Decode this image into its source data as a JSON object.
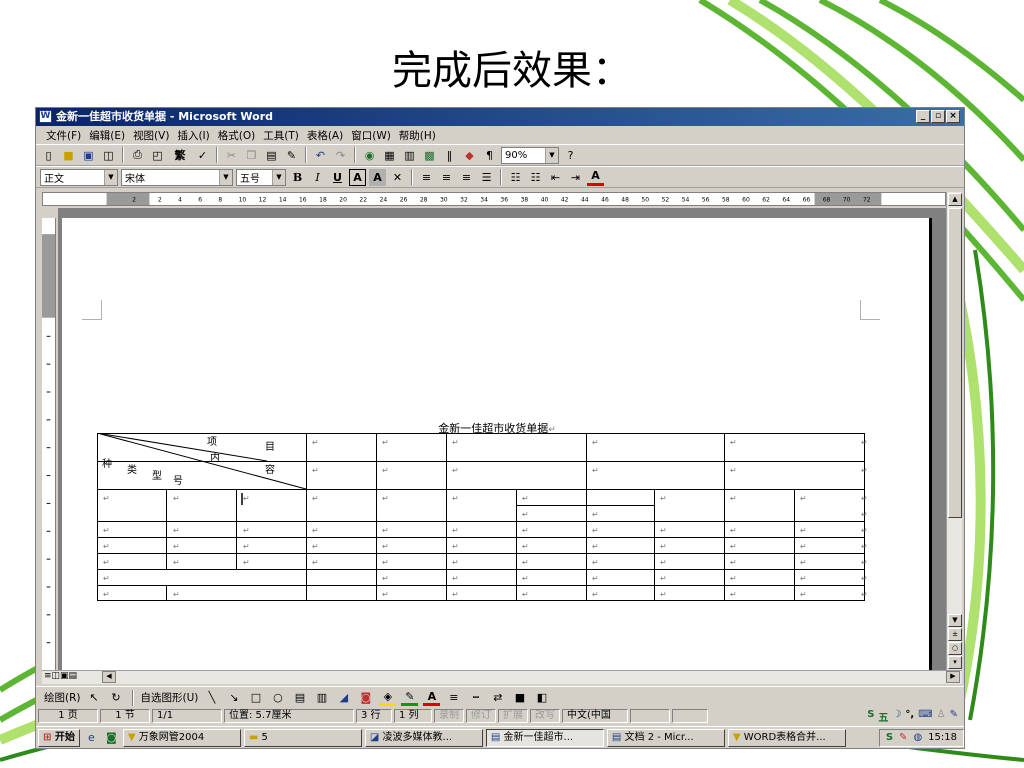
{
  "slide": {
    "title": "完成后效果："
  },
  "window": {
    "title": "金新一佳超市收货单据 - Microsoft Word",
    "icon_letter": "W",
    "controls": [
      "_",
      "▫",
      "×"
    ]
  },
  "menu": [
    "文件(F)",
    "编辑(E)",
    "视图(V)",
    "插入(I)",
    "格式(O)",
    "工具(T)",
    "表格(A)",
    "窗口(W)",
    "帮助(H)"
  ],
  "toolbar": {
    "zoom": "90%",
    "style": "正文",
    "font": "宋体",
    "size": "五号"
  },
  "ruler": {
    "labels": [
      "2",
      "2",
      "4",
      "6",
      "8",
      "10",
      "12",
      "14",
      "16",
      "18",
      "20",
      "22",
      "24",
      "26",
      "28",
      "30",
      "32",
      "34",
      "36",
      "38",
      "40",
      "42",
      "44",
      "46",
      "48",
      "50",
      "52",
      "54",
      "56",
      "58",
      "60",
      "62",
      "64",
      "66",
      "68",
      "70",
      "72"
    ]
  },
  "document": {
    "title": "金新一佳超市收货单据",
    "header_cell": {
      "item": "项",
      "mu": "目",
      "nei": "内",
      "rong": "容",
      "zhong": "种",
      "lei": "类",
      "xing": "型",
      "hao": "号"
    },
    "para_mark": "↵"
  },
  "drawbar": {
    "draw": "绘图(R)",
    "autoshapes": "自选图形(U)"
  },
  "status": {
    "page": "1 页",
    "section": "1 节",
    "pages": "1/1",
    "position": "位置: 5.7厘米",
    "line": "3 行",
    "col": "1 列",
    "rec": "录制",
    "trk": "修订",
    "ext": "扩展",
    "ovr": "改写",
    "lang": "中文(中国"
  },
  "taskbar": {
    "start": "开始",
    "items": [
      "万象网管2004",
      "5",
      "凌波多媒体教...",
      "金新一佳超市...",
      "文档 2 - Micr...",
      "WORD表格合并..."
    ],
    "clock": "15:18",
    "ime": "五"
  }
}
